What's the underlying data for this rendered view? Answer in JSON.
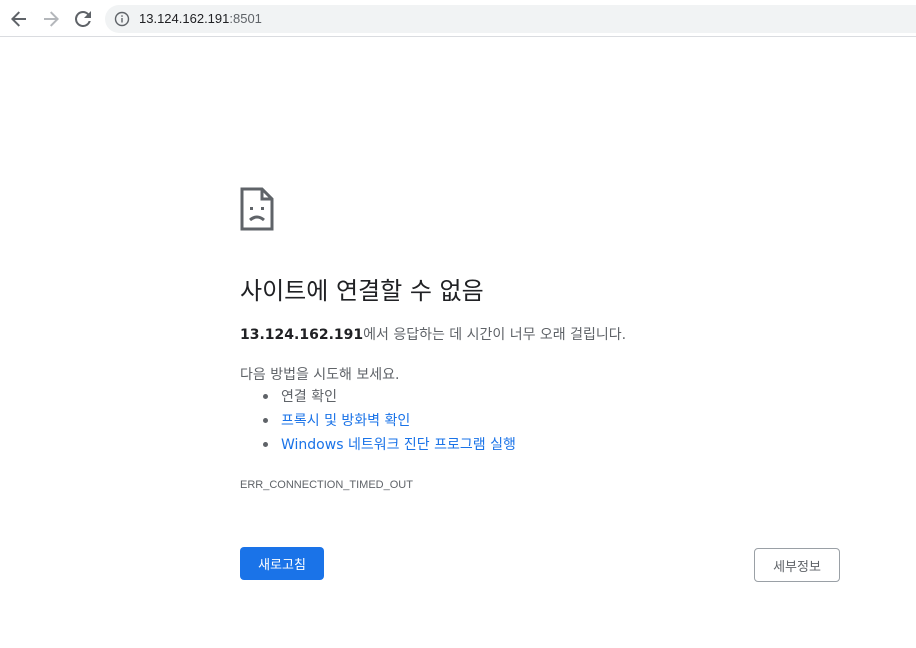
{
  "browser": {
    "url_host": "13.124.162.191",
    "url_port": ":8501",
    "icons": {
      "back": "back-arrow-icon",
      "forward": "forward-arrow-icon",
      "reload": "reload-icon",
      "info": "info-icon"
    }
  },
  "error_page": {
    "icon": "sad-page-icon",
    "title": "사이트에 연결할 수 없음",
    "host_bold": "13.124.162.191",
    "description_suffix": "에서 응답하는 데 시간이 너무 오래 걸립니다.",
    "suggest_intro": "다음 방법을 시도해 보세요.",
    "suggestions": [
      {
        "label": "연결 확인",
        "is_link": false
      },
      {
        "label": "프록시 및 방화벽 확인",
        "is_link": true
      },
      {
        "label": "Windows 네트워크 진단 프로그램 실행",
        "is_link": true
      }
    ],
    "error_code": "ERR_CONNECTION_TIMED_OUT",
    "reload_label": "새로고침",
    "details_label": "세부정보"
  },
  "colors": {
    "accent": "#1a73e8",
    "text_primary": "#202124",
    "text_secondary": "#5f6368",
    "omnibox_bg": "#f1f3f4"
  }
}
